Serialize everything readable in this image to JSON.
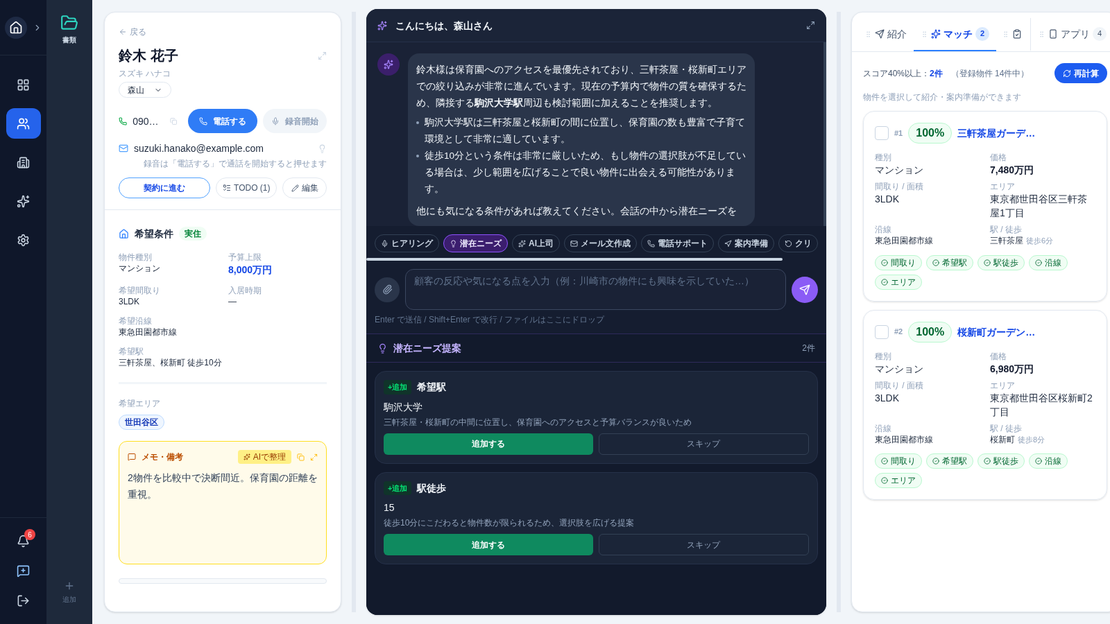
{
  "rail": {
    "nav": [
      {
        "selected": false
      },
      {
        "selected": true
      },
      {
        "selected": false
      },
      {
        "selected": false
      },
      {
        "selected": false
      }
    ],
    "notifications": "6"
  },
  "sub_rail": {
    "top": "書類",
    "add": "追加"
  },
  "customer": {
    "back": "戻る",
    "name": "鈴木 花子",
    "kana": "スズキ ハナコ",
    "assignee": "森山",
    "phone": "090…",
    "call_button": "電話する",
    "record_button": {
      "label": "録音開始",
      "disabled": true
    },
    "email": "suzuki.hanako@example.com",
    "record_hint": "録音は「電話する」で通話を開始すると押せます",
    "actions": [
      "契約に進む",
      "TODO (1)",
      "編集"
    ]
  },
  "conditions": {
    "title": "希望条件",
    "badge": "実住",
    "fields": [
      {
        "kind": "half",
        "label": "物件種別",
        "value": "マンション"
      },
      {
        "kind": "half",
        "label": "予算上限",
        "value": "8,000万円",
        "emphasis": true
      },
      {
        "kind": "half",
        "label": "希望間取り",
        "value": "3LDK"
      },
      {
        "kind": "half",
        "label": "入居時期",
        "value": "—"
      },
      {
        "kind": "full",
        "label": "希望沿線",
        "value": "東急田園都市線"
      },
      {
        "kind": "full",
        "label": "希望駅",
        "value": "三軒茶屋、桜新町 徒歩10分"
      }
    ],
    "area_label": "希望エリア",
    "areas": [
      "世田谷区"
    ]
  },
  "memo": {
    "title": "メモ・備考",
    "ai_button": "AIで整理",
    "text": "2物件を比較中で決断間近。保育園の距離を重視。"
  },
  "assistant": {
    "greeting": "こんにちは、森山さん",
    "message": {
      "intro": "鈴木様は保育園へのアクセスを最優先されており、三軒茶屋・桜新町エリアでの絞り込みが非常に進んでいます。現在の予算内で物件の質を確保するため、隣接する**駒沢大学駅**周辺も検討範囲に加えることを推奨します。",
      "bullets": [
        "駒沢大学駅は三軒茶屋と桜新町の間に位置し、保育園の数も豊富で子育て環境として非常に適しています。",
        "徒歩10分という条件は非常に厳しいため、もし物件の選択肢が不足している場合は、少し範囲を広げることで良い物件に出会える可能性があります。"
      ],
      "outro": "他にも気になる条件があれば教えてください。会話の中から潜在ニーズを"
    },
    "chips": [
      {
        "label": "ヒアリング",
        "selected": false
      },
      {
        "label": "潜在ニーズ",
        "selected": true
      },
      {
        "label": "AI上司",
        "selected": false
      },
      {
        "label": "メール文作成",
        "selected": false
      },
      {
        "label": "電話サポート",
        "selected": false
      },
      {
        "label": "案内準備",
        "selected": false
      },
      {
        "label": "クリ",
        "selected": false
      }
    ],
    "input": {
      "placeholder": "顧客の反応や気になる点を入力（例：川崎市の物件にも興味を示していた…）"
    },
    "input_hint": "Enter で送信 / Shift+Enter で改行 / ファイルはここにドロップ",
    "suggestions": {
      "title": "潜在ニーズ提案",
      "count": "2件",
      "items": [
        {
          "tag": "+追加",
          "field": "希望駅",
          "value": "駒沢大学",
          "reason": "三軒茶屋・桜新町の中間に位置し、保育園へのアクセスと予算バランスが良いため",
          "add": "追加する",
          "skip": "スキップ"
        },
        {
          "tag": "+追加",
          "field": "駅徒歩",
          "value": "15",
          "reason": "徒歩10分にこだわると物件数が限られるため、選択肢を広げる提案",
          "add": "追加する",
          "skip": "スキップ"
        }
      ]
    }
  },
  "matches": {
    "tabs": [
      {
        "label": "紹介",
        "selected": false
      },
      {
        "label": "マッチ",
        "badge": "2",
        "selected": true
      },
      {
        "selected": false
      },
      {
        "label": "アプリ",
        "badge": "4",
        "selected": false
      }
    ],
    "score_label": "スコア40%以上：",
    "score_count": "2件",
    "score_note": "（登録物件 14件中）",
    "recalc": "再計算",
    "hint": "物件を選択して紹介・案内準備ができます",
    "properties": [
      {
        "checked": false,
        "rank": "#1",
        "score": "100%",
        "name": "三軒茶屋ガーデ…",
        "fields": [
          {
            "label": "種別",
            "value": "マンション"
          },
          {
            "label": "価格",
            "value": "7,480万円",
            "emphasis": true
          },
          {
            "label": "間取り / 面積",
            "value": "3LDK"
          },
          {
            "label": "エリア",
            "value": "東京都世田谷区三軒茶屋1丁目"
          },
          {
            "label": "沿線",
            "value": "東急田園都市線"
          },
          {
            "label": "駅 / 徒歩",
            "value": "三軒茶屋",
            "note": "徒歩6分"
          }
        ],
        "tags": [
          "間取り",
          "希望駅",
          "駅徒歩",
          "沿線",
          "エリア"
        ]
      },
      {
        "checked": false,
        "rank": "#2",
        "score": "100%",
        "name": "桜新町ガーデン…",
        "fields": [
          {
            "label": "種別",
            "value": "マンション"
          },
          {
            "label": "価格",
            "value": "6,980万円",
            "emphasis": true
          },
          {
            "label": "間取り / 面積",
            "value": "3LDK"
          },
          {
            "label": "エリア",
            "value": "東京都世田谷区桜新町2丁目"
          },
          {
            "label": "沿線",
            "value": "東急田園都市線"
          },
          {
            "label": "駅 / 徒歩",
            "value": "桜新町",
            "note": "徒歩8分"
          }
        ],
        "tags": [
          "間取り",
          "希望駅",
          "駅徒歩",
          "沿線",
          "エリア"
        ]
      }
    ]
  }
}
